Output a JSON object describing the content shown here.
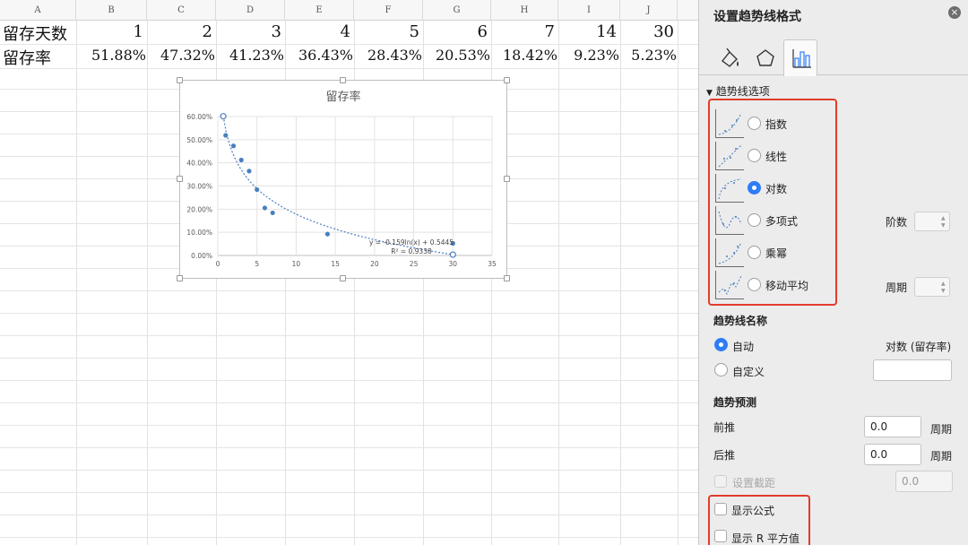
{
  "sheet": {
    "columns": [
      "A",
      "B",
      "C",
      "D",
      "E",
      "F",
      "G",
      "H",
      "I",
      "J"
    ],
    "row1": {
      "label": "留存天数",
      "values": [
        "1",
        "2",
        "3",
        "4",
        "5",
        "6",
        "7",
        "14",
        "30"
      ]
    },
    "row2": {
      "label": "留存率",
      "values": [
        "51.88%",
        "47.32%",
        "41.23%",
        "36.43%",
        "28.43%",
        "20.53%",
        "18.42%",
        "9.23%",
        "5.23%"
      ]
    }
  },
  "chart_data": {
    "type": "scatter",
    "title": "留存率",
    "x": [
      1,
      2,
      3,
      4,
      5,
      6,
      7,
      14,
      30
    ],
    "y": [
      0.5188,
      0.4732,
      0.4123,
      0.3643,
      0.2843,
      0.2053,
      0.1842,
      0.0923,
      0.0523
    ],
    "xlim": [
      0,
      35
    ],
    "ylim": [
      0,
      0.6
    ],
    "x_ticks": [
      "0",
      "5",
      "10",
      "15",
      "20",
      "25",
      "30",
      "35"
    ],
    "y_ticks": [
      "0.00%",
      "10.00%",
      "20.00%",
      "30.00%",
      "40.00%",
      "50.00%",
      "60.00%"
    ],
    "trendline": {
      "type": "log",
      "a": -0.159,
      "b": 0.5445
    },
    "equation": "y = -0.159ln(x) + 0.5445",
    "r2": "R² = 0.9338",
    "grid": true,
    "colors": {
      "points": "#4a7fbf",
      "trend": "#4a7fbf"
    }
  },
  "panel": {
    "title": "设置趋势线格式",
    "close_icon": "×",
    "section_options": "趋势线选项",
    "toggle_icon": "▼",
    "trend_types": [
      {
        "label": "指数",
        "selected": false
      },
      {
        "label": "线性",
        "selected": false
      },
      {
        "label": "对数",
        "selected": true
      },
      {
        "label": "多项式",
        "selected": false
      },
      {
        "label": "乘幂",
        "selected": false
      },
      {
        "label": "移动平均",
        "selected": false
      }
    ],
    "order_label": "阶数",
    "period_label": "周期",
    "name_section": "趋势线名称",
    "auto_label": "自动",
    "auto_value": "对数 (留存率)",
    "custom_label": "自定义",
    "forecast_section": "趋势预测",
    "forward_label": "前推",
    "forward_value": "0.0",
    "forward_unit": "周期",
    "backward_label": "后推",
    "backward_value": "0.0",
    "backward_unit": "周期",
    "intercept_label": "设置截距",
    "intercept_value": "0.0",
    "show_equation": "显示公式",
    "show_r2": "显示 R 平方值",
    "accent": "#2e7cf6",
    "highlight": "#e23c2c"
  }
}
